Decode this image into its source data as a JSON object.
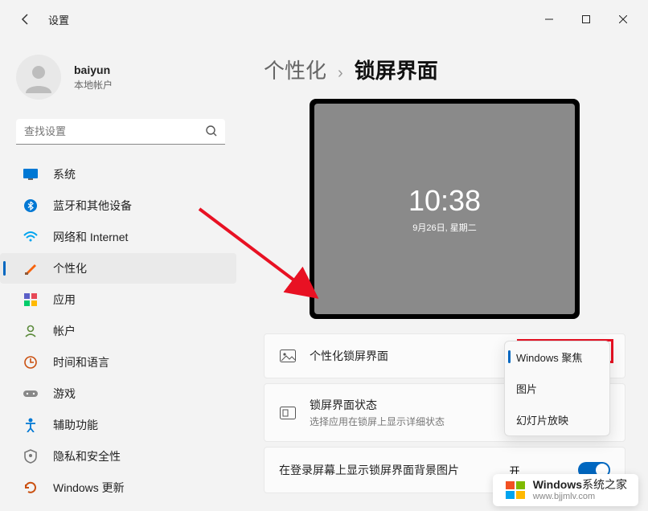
{
  "window": {
    "title": "设置"
  },
  "profile": {
    "name": "baiyun",
    "subtitle": "本地帐户"
  },
  "search": {
    "placeholder": "查找设置"
  },
  "nav": {
    "items": [
      {
        "label": "系统"
      },
      {
        "label": "蓝牙和其他设备"
      },
      {
        "label": "网络和 Internet"
      },
      {
        "label": "个性化"
      },
      {
        "label": "应用"
      },
      {
        "label": "帐户"
      },
      {
        "label": "时间和语言"
      },
      {
        "label": "游戏"
      },
      {
        "label": "辅助功能"
      },
      {
        "label": "隐私和安全性"
      },
      {
        "label": "Windows 更新"
      }
    ],
    "active_index": 3
  },
  "breadcrumb": {
    "parent": "个性化",
    "current": "锁屏界面"
  },
  "preview": {
    "time": "10:38",
    "date": "9月26日, 星期二"
  },
  "settings": {
    "personalize": {
      "title": "个性化锁屏界面",
      "dropdown": {
        "options": [
          "Windows 聚焦",
          "图片",
          "幻灯片放映"
        ],
        "selected_index": 0
      }
    },
    "status": {
      "title": "锁屏界面状态",
      "subtitle": "选择应用在锁屏上显示详细状态"
    },
    "background_toggle": {
      "title": "在登录屏幕上显示锁屏界面背景图片",
      "on_label": "开"
    }
  },
  "watermark": {
    "brand": "Windows",
    "suffix": "系统之家",
    "url": "www.bjjmlv.com"
  }
}
